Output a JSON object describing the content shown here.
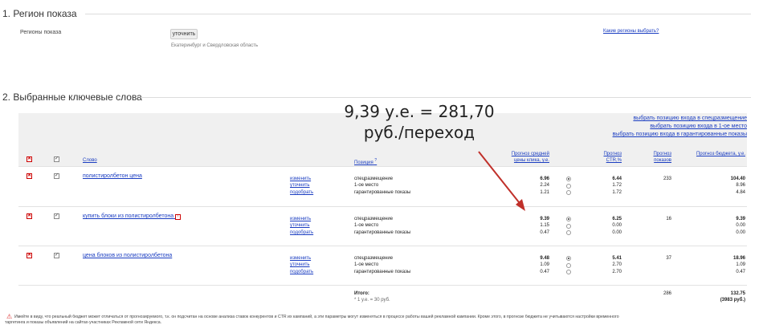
{
  "section1": {
    "title": "1. Регион показа",
    "label": "Регионы показа",
    "button": "уточнить",
    "region_value": "Екатеринбург и Свердловская область",
    "help_link": "Какие регионы выбрать?"
  },
  "section2": {
    "title": "2. Выбранные ключевые слова",
    "links": [
      "выбрать позицию входа в спецразмещение",
      "выбрать позицию входа в 1-ое место",
      "выбрать позицию входа в гарантированные показы"
    ]
  },
  "annotation": {
    "line1": "9,39 у.е. = 281,70",
    "line2": "руб./переход"
  },
  "table": {
    "headers": {
      "word": "Слово",
      "position": "Позиция",
      "position_sup": "?",
      "price": "Прогноз средней цены клика, у.е.",
      "ctr": "Прогноз CTR,%",
      "shows": "Прогноз показов",
      "budget": "Прогноз бюджета, у.е."
    },
    "actions": [
      "изменить",
      "уточнить",
      "подобрать"
    ],
    "positions": [
      "спецразмещение",
      "1-ое место",
      "гарантированные показы"
    ],
    "rows": [
      {
        "word": "полистиролбетон цена",
        "prices": [
          "6.96",
          "2.24",
          "1.21"
        ],
        "ctr": [
          "6.44",
          "1.72",
          "1.72"
        ],
        "shows": "233",
        "budget": [
          "104.40",
          "8.96",
          "4.84"
        ],
        "selected": 0,
        "flag": false
      },
      {
        "word": "купить блоки из полистиролбетона",
        "prices": [
          "9.39",
          "1.15",
          "0.47"
        ],
        "ctr": [
          "6.25",
          "0.00",
          "0.00"
        ],
        "shows": "16",
        "budget": [
          "9.39",
          "0.00",
          "0.00"
        ],
        "selected": 0,
        "flag": true
      },
      {
        "word": "цена блоков из полистиролбетона",
        "prices": [
          "9.48",
          "1.09",
          "0.47"
        ],
        "ctr": [
          "5.41",
          "2.70",
          "2.70"
        ],
        "shows": "37",
        "budget": [
          "18.96",
          "1.09",
          "0.47"
        ],
        "selected": 0,
        "flag": false
      }
    ],
    "total": {
      "label": "Итого:",
      "note": "* 1 у.е. = 30 руб.",
      "shows": "286",
      "budget": "132.75",
      "budget_rub": "(3983 руб.)"
    }
  },
  "footer": {
    "text1": "Имейте в виду, что реальный бюджет может отличаться от прогнозируемого, т.к. он подсчитан на основе анализа ставок конкурентов и CTR их кампаний, а эти параметры могут изменяться в процессе работы вашей рекламной кампании. Кроме этого, в прогнозе бюджета не учитываются настройки временного",
    "text2": "таргетинга и показы объявлений на сайтах-участниках Рекламной сети Яндекса."
  },
  "colors": {
    "link": "#1a3dc1",
    "arrow": "#c0302a",
    "delete": "#cc0000"
  }
}
